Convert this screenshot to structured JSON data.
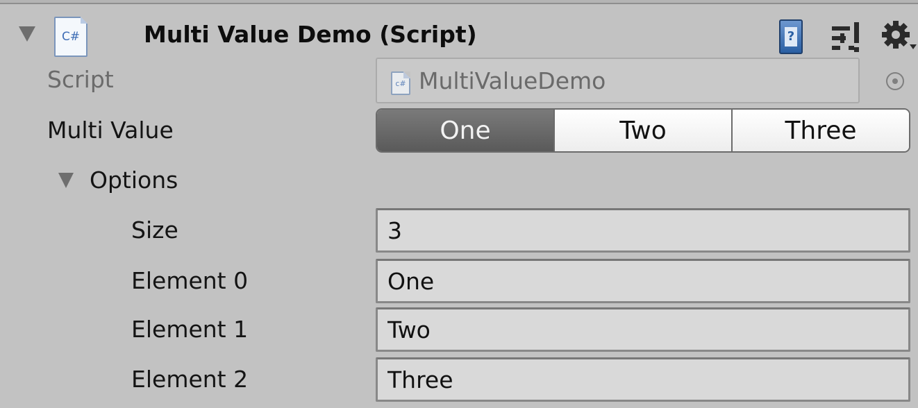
{
  "component": {
    "title": "Multi Value Demo (Script)",
    "file_icon_text": "C#"
  },
  "header_icons": {
    "help": "?",
    "help_icon_name": "help-book-icon",
    "presets_icon_name": "presets-icon",
    "settings_icon_name": "gear-icon"
  },
  "script_row": {
    "label": "Script",
    "value": "MultiValueDemo",
    "file_icon_text": "c#"
  },
  "multi_value": {
    "label": "Multi Value",
    "segments": [
      "One",
      "Two",
      "Three"
    ],
    "selected": "One"
  },
  "options": {
    "label": "Options",
    "size_label": "Size",
    "size_value": "3",
    "elements": [
      {
        "label": "Element 0",
        "value": "One"
      },
      {
        "label": "Element 1",
        "value": "Two"
      },
      {
        "label": "Element 2",
        "value": "Three"
      }
    ]
  },
  "colors": {
    "background": "#c2c2c2",
    "selected_segment": "#666666",
    "csharp_icon": "#3d6db5",
    "help_icon": "#2a5fa3"
  }
}
